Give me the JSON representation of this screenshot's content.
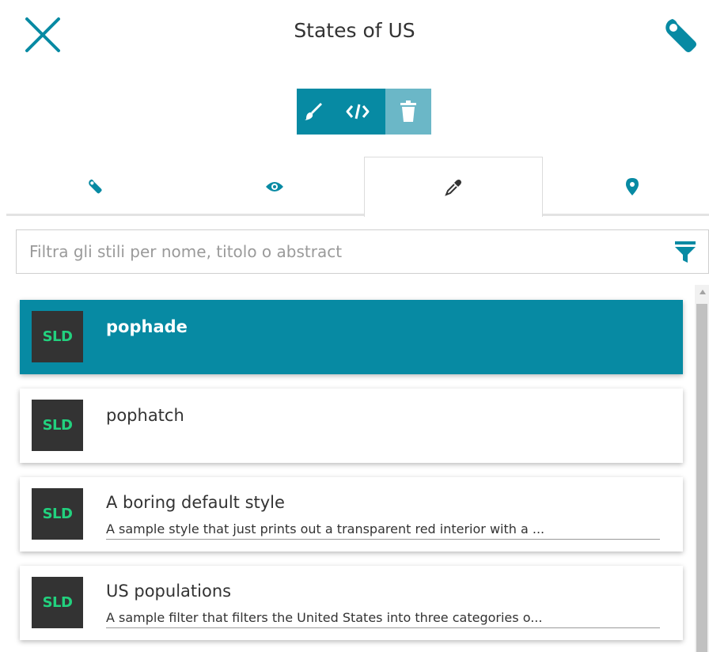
{
  "header": {
    "title": "States of US",
    "close_icon": "close-icon",
    "settings_icon": "wrench-icon"
  },
  "toolbar": {
    "buttons": [
      {
        "name": "edit-style",
        "icon": "brush-icon"
      },
      {
        "name": "code-editor",
        "icon": "code-icon"
      },
      {
        "name": "delete-style",
        "icon": "trash-icon"
      }
    ]
  },
  "tabs": [
    {
      "name": "general",
      "icon": "wrench-icon",
      "active": false
    },
    {
      "name": "display",
      "icon": "eye-icon",
      "active": false
    },
    {
      "name": "style",
      "icon": "eyedropper-icon",
      "active": true
    },
    {
      "name": "feature-info",
      "icon": "map-marker-icon",
      "active": false
    }
  ],
  "filter": {
    "placeholder": "Filtra gli stili per nome, titolo o abstract",
    "value": "",
    "icon": "filter-icon"
  },
  "styles": [
    {
      "badge": "SLD",
      "title": "pophade",
      "description": "",
      "selected": true
    },
    {
      "badge": "SLD",
      "title": "pophatch",
      "description": "",
      "selected": false
    },
    {
      "badge": "SLD",
      "title": "A boring default style",
      "description": "A sample style that just prints out a transparent red interior with a ...",
      "selected": false
    },
    {
      "badge": "SLD",
      "title": "US populations",
      "description": "A sample filter that filters the United States into three categories o...",
      "selected": false
    }
  ],
  "colors": {
    "accent": "#078aa3",
    "accent_light": "#6bb7c7",
    "badge_bg": "#333333",
    "badge_text": "#22d17e"
  }
}
